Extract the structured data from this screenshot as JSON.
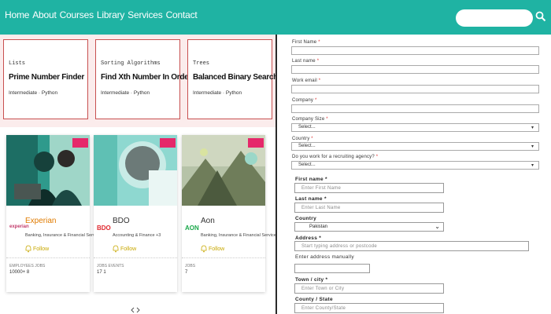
{
  "nav": {
    "items": [
      "Home",
      "About",
      "Courses",
      "Library",
      "Services",
      "Contact"
    ]
  },
  "search": {
    "placeholder": ""
  },
  "courses": [
    {
      "category": "Lists",
      "title": "Prime Number Finder",
      "meta": "Intermediate · Python"
    },
    {
      "category": "Sorting Algorithms",
      "title": "Find Xth Number In Order",
      "meta": "Intermediate · Python"
    },
    {
      "category": "Trees",
      "title": "Balanced Binary Search Tree",
      "meta": "Intermediate · Python"
    }
  ],
  "employers": [
    {
      "name": "Experian",
      "logo": "experian",
      "sector": "Banking, Insurance & Financial Services +5",
      "follow": "Follow",
      "stat_labels": "EMPLOYEES    JOBS",
      "stat_values": "10000+       8"
    },
    {
      "name": "BDO",
      "logo": "BDO",
      "sector": "Accounting & Finance +3",
      "follow": "Follow",
      "stat_labels": "JOBS    EVENTS",
      "stat_values": "17      1"
    },
    {
      "name": "Aon",
      "logo": "AON",
      "sector": "Banking, Insurance & Financial Services",
      "follow": "Follow",
      "stat_labels": "JOBS",
      "stat_values": "7"
    }
  ],
  "form1": {
    "first_name": "First Name",
    "last_name": "Last name",
    "work_email": "Work email",
    "company": "Company",
    "company_size": "Company Size",
    "company_size_value": "Select...",
    "country": "Country",
    "country_value": "Select...",
    "agency": "Do you work for a recruiting agency?",
    "agency_value": "Select..."
  },
  "form2": {
    "first_name": "First name *",
    "first_name_ph": "Enter First Name",
    "last_name": "Last name *",
    "last_name_ph": "Enter Last Name",
    "country": "Country",
    "country_value": "Pakistan",
    "address": "Address *",
    "address_ph": "Start typing address or postcode",
    "address_manual": "Enter address manually",
    "town": "Town / city *",
    "town_ph": "Enter Town or City",
    "county": "County / State",
    "county_ph": "Enter County/State"
  },
  "colors": {
    "header": "#1fb3a3",
    "course_border": "#c85050",
    "badge": "#e5286a",
    "follow": "#c8a800"
  }
}
